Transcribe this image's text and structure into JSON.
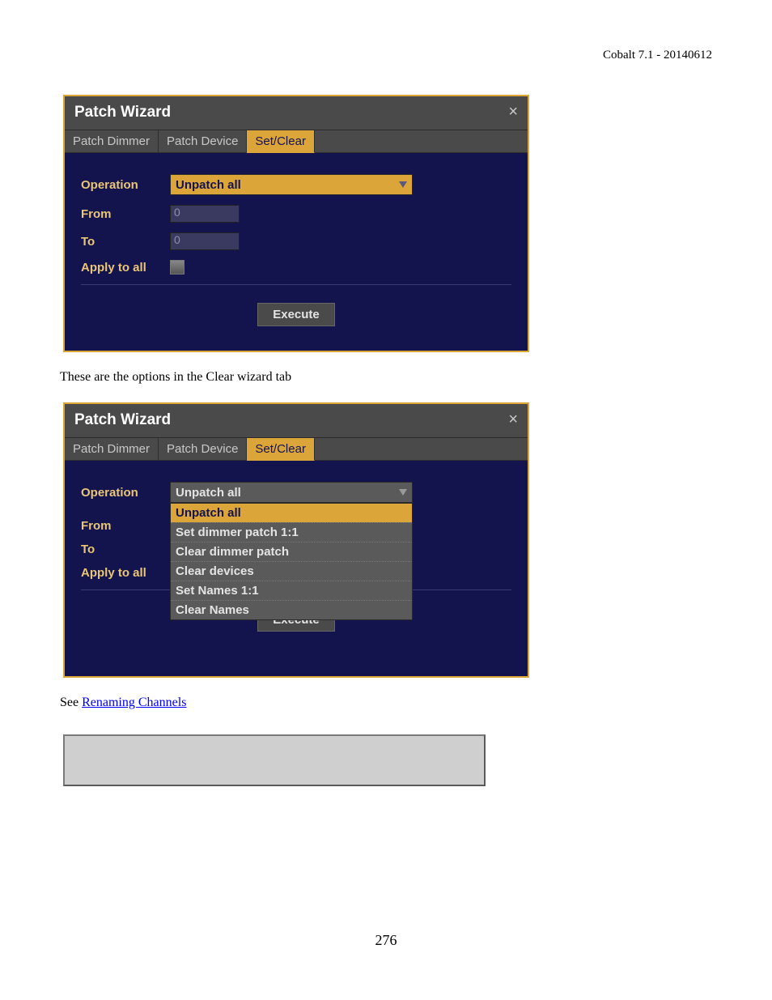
{
  "header": {
    "text": "Cobalt 7.1 - 20140612"
  },
  "wizard1": {
    "title": "Patch Wizard",
    "tabs": {
      "t1": "Patch Dimmer",
      "t2": "Patch Device",
      "t3": "Set/Clear"
    },
    "labels": {
      "operation": "Operation",
      "from": "From",
      "to": "To",
      "apply": "Apply to all"
    },
    "operation_value": "Unpatch all",
    "from_value": "0",
    "to_value": "0",
    "execute": "Execute"
  },
  "caption1": "These are the options in the Clear wizard tab",
  "wizard2": {
    "title": "Patch Wizard",
    "tabs": {
      "t1": "Patch Dimmer",
      "t2": "Patch Device",
      "t3": "Set/Clear"
    },
    "labels": {
      "operation": "Operation",
      "from": "From",
      "to": "To",
      "apply": "Apply to all"
    },
    "operation_value": "Unpatch all",
    "options": {
      "o0": "Unpatch all",
      "o1": "Set dimmer patch 1:1",
      "o2": "Clear dimmer patch",
      "o3": "Clear devices",
      "o4": "Set Names 1:1",
      "o5": "Clear Names"
    },
    "execute": "Execute"
  },
  "see_prefix": "See ",
  "see_link": "Renaming Channels",
  "page_number": "276"
}
